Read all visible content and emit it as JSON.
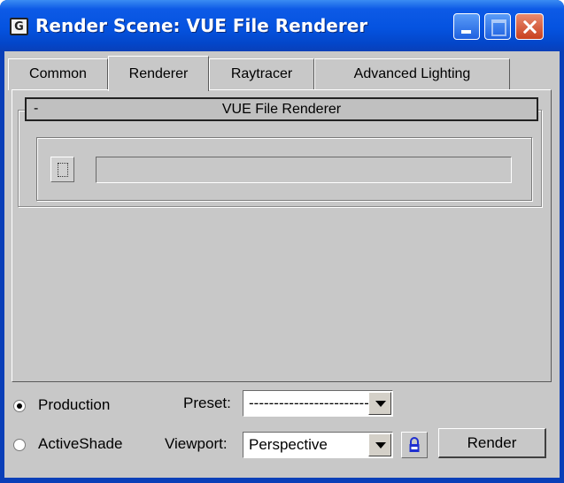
{
  "window": {
    "title": "Render Scene: VUE File Renderer",
    "app_icon_glyph": "G",
    "icons": [
      "app-icon",
      "minimize-icon",
      "maximize-icon",
      "close-icon"
    ]
  },
  "tabs": [
    {
      "label": "Common",
      "active": false
    },
    {
      "label": "Renderer",
      "active": true
    },
    {
      "label": "Raytracer",
      "active": false
    },
    {
      "label": "Advanced Lighting",
      "active": false
    }
  ],
  "rollout": {
    "toggle": "-",
    "title": "VUE File Renderer",
    "file_value": ""
  },
  "bottom": {
    "mode_production": "Production",
    "mode_activeshade": "ActiveShade",
    "selected_mode": "Production",
    "preset_label": "Preset:",
    "preset_value": "------------------------",
    "viewport_label": "Viewport:",
    "viewport_value": "Perspective",
    "render_label": "Render"
  },
  "colors": {
    "titlebar": "#0553e0",
    "panel": "#c8c8c8",
    "close_button": "#c8401e",
    "lock_icon": "#1f2fd0"
  }
}
